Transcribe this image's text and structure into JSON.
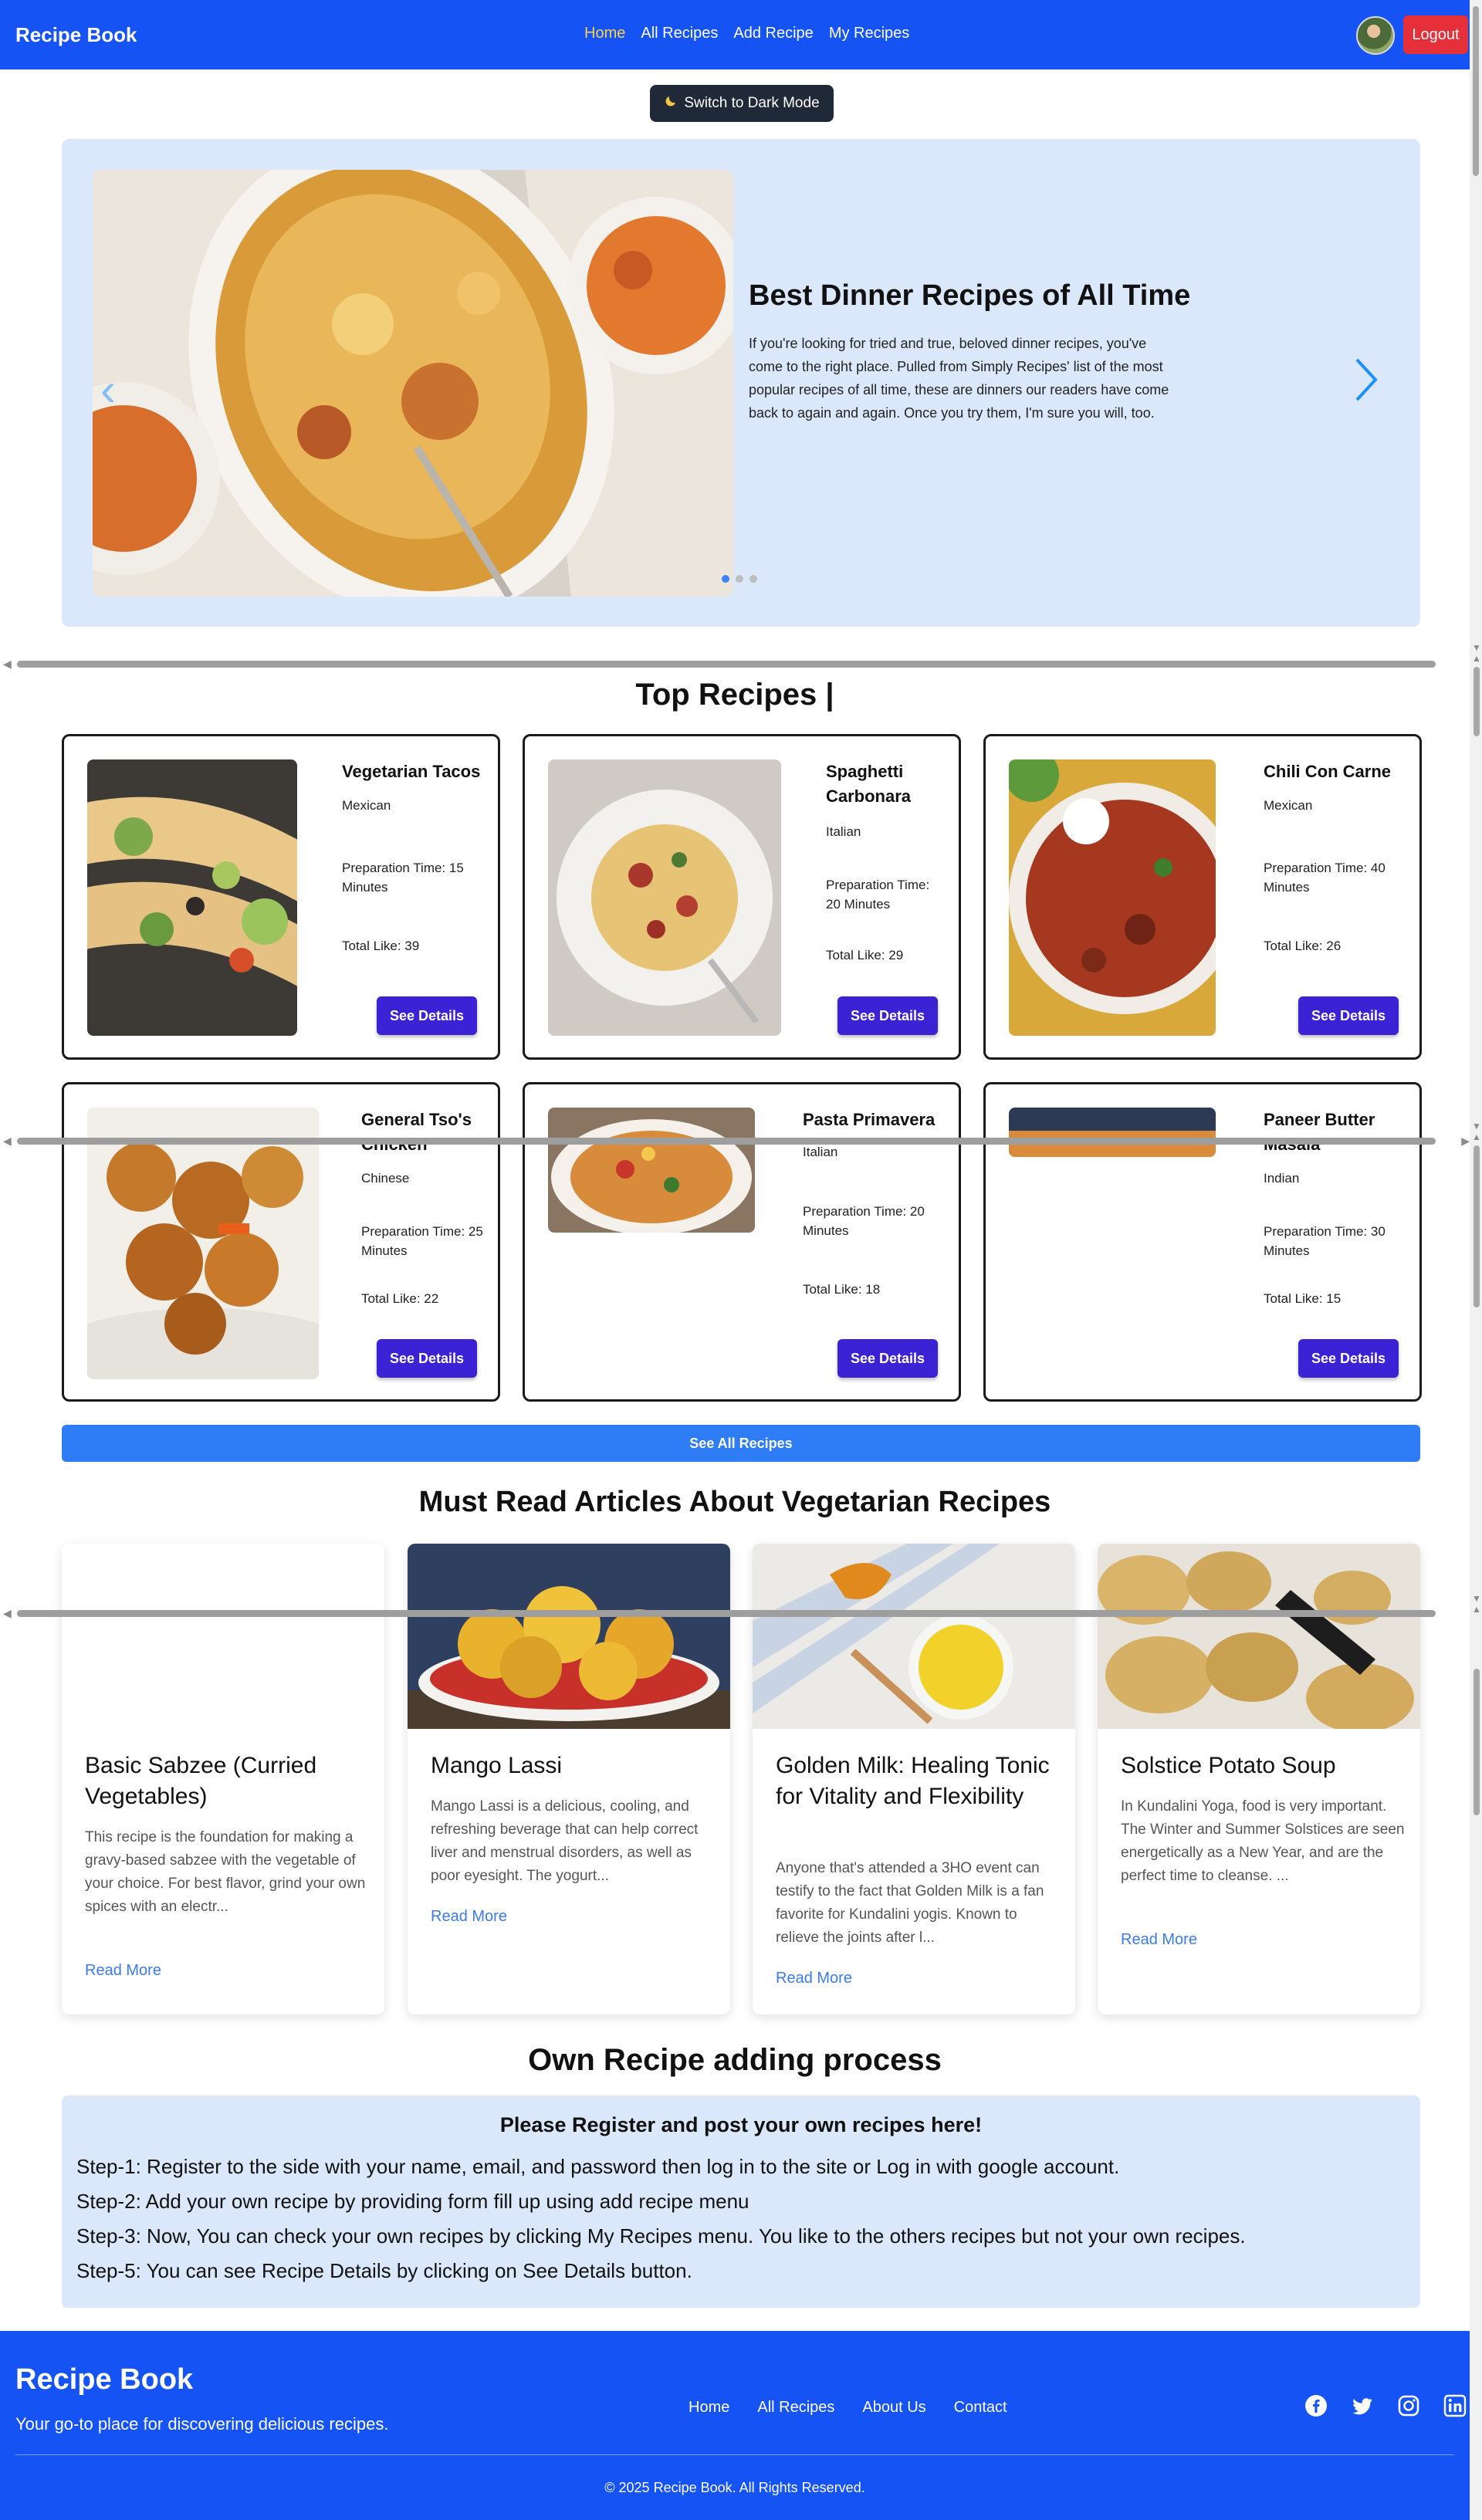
{
  "navbar": {
    "brand": "Recipe Book",
    "links": [
      "Home",
      "All Recipes",
      "Add Recipe",
      "My Recipes"
    ],
    "logout_label": "Logout"
  },
  "theme_toggle": {
    "icon": "moon-icon",
    "label": "Switch to Dark Mode"
  },
  "banner": {
    "title": "Best Dinner Recipes of All Time",
    "text": "If you're looking for tried and true, beloved dinner recipes, you've come to the right place. Pulled from Simply Recipes' list of the most popular recipes of all time, these are dinners our readers have come back to again and again. Once you try them, I'm sure you will, too.",
    "slide_count": 3,
    "active_slide": 1
  },
  "top_recipes": {
    "title": "Top Recipes |",
    "button_label": "See Details",
    "items": [
      {
        "name": "Vegetarian Tacos",
        "cuisine": "Mexican",
        "prep": "Preparation Time: 15 Minutes",
        "likes": "Total Like: 39"
      },
      {
        "name": "Spaghetti Carbonara",
        "cuisine": "Italian",
        "prep": "Preparation Time: 20 Minutes",
        "likes": "Total Like: 29"
      },
      {
        "name": "Chili Con Carne",
        "cuisine": "Mexican",
        "prep": "Preparation Time: 40 Minutes",
        "likes": "Total Like: 26"
      },
      {
        "name": "General Tso's Chicken",
        "cuisine": "Chinese",
        "prep": "Preparation Time: 25 Minutes",
        "likes": "Total Like: 22"
      },
      {
        "name": "Pasta Primavera",
        "cuisine": "Italian",
        "prep": "Preparation Time: 20 Minutes",
        "likes": "Total Like: 18"
      },
      {
        "name": "Paneer Butter Masala",
        "cuisine": "Indian",
        "prep": "Preparation Time: 30 Minutes",
        "likes": "Total Like: 15"
      }
    ],
    "see_all_label": "See All Recipes"
  },
  "articles": {
    "title": "Must Read Articles About Vegetarian Recipes",
    "link_label": "Read More",
    "items": [
      {
        "name": "Basic Sabzee (Curried Vegetables)",
        "desc": "This recipe is the foundation for making a gravy-based sabzee with the vegetable of your choice. For best flavor, grind your own spices with an electr..."
      },
      {
        "name": "Mango Lassi",
        "desc": "Mango Lassi is a delicious, cooling, and refreshing beverage that can help correct liver and menstrual disorders, as well as poor eyesight. The yogurt..."
      },
      {
        "name": "Golden Milk: Healing Tonic for Vitality and Flexibility",
        "desc": "Anyone that's attended a 3HO event can testify to the fact that Golden Milk is a fan favorite for Kundalini yogis. Known to relieve the joints after l..."
      },
      {
        "name": "Solstice Potato Soup",
        "desc": "In Kundalini Yoga, food is very important. The Winter and Summer Solstices are seen energetically as a New Year, and are the perfect time to cleanse. ..."
      }
    ]
  },
  "process": {
    "title": "Own Recipe adding process",
    "heading": "Please Register and post your own recipes here!",
    "steps": [
      "Step-1: Register to the side with your name, email, and password then log in to the site or Log in with google account.",
      "Step-2: Add your own recipe by providing form fill up using add recipe menu",
      "Step-3: Now, You can check your own recipes by clicking My Recipes menu. You like to the others recipes but not your own recipes.",
      "Step-5: You can see Recipe Details by clicking on See Details button."
    ]
  },
  "footer": {
    "brand": "Recipe Book",
    "tagline": "Your go-to place for discovering delicious recipes.",
    "links": [
      "Home",
      "All Recipes",
      "About Us",
      "Contact"
    ],
    "social": [
      "facebook-icon",
      "twitter-icon",
      "instagram-icon",
      "linkedin-icon"
    ],
    "copyright": "© 2025 Recipe Book. All Rights Reserved."
  },
  "colors": {
    "navbar": "#1653f5",
    "active_link": "#f7d44c",
    "logout": "#e5303a",
    "banner_bg": "#dbe8fc",
    "details_button": "#3b22d4",
    "see_all_button": "#2e7cf6",
    "read_more": "#3d7be8"
  }
}
